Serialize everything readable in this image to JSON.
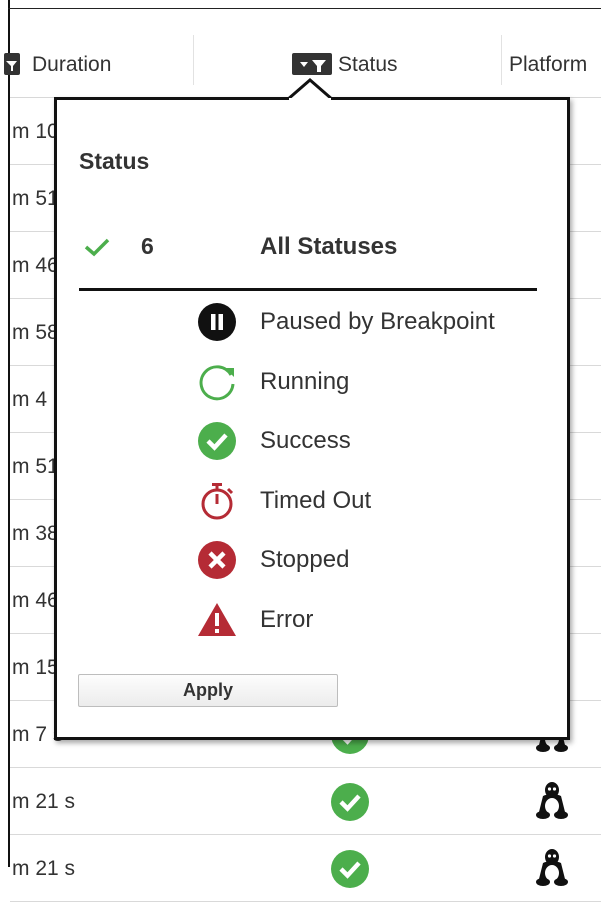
{
  "header": {
    "duration_label": "Duration",
    "status_label": "Status",
    "platform_label": "Platform"
  },
  "rows": [
    {
      "duration": "m 10"
    },
    {
      "duration": "m 51"
    },
    {
      "duration": "m 46"
    },
    {
      "duration": "m 58"
    },
    {
      "duration": " m 4"
    },
    {
      "duration": "m 51"
    },
    {
      "duration": "m 38"
    },
    {
      "duration": "m 46"
    },
    {
      "duration": "m 15"
    },
    {
      "duration": "m 7 s",
      "status_icon": "success-icon",
      "platform_icon": "linux-icon"
    },
    {
      "duration": "m 21 s",
      "status_icon": "success-icon",
      "platform_icon": "linux-icon"
    },
    {
      "duration": "m 21 s",
      "status_icon": "success-icon",
      "platform_icon": "linux-icon"
    }
  ],
  "popover": {
    "title": "Status",
    "all": {
      "count": "6",
      "label": "All Statuses",
      "checked": true
    },
    "options": [
      {
        "label": "Paused by Breakpoint",
        "icon": "pause-icon"
      },
      {
        "label": "Running",
        "icon": "running-icon"
      },
      {
        "label": "Success",
        "icon": "success-icon"
      },
      {
        "label": "Timed Out",
        "icon": "timer-icon"
      },
      {
        "label": "Stopped",
        "icon": "stopped-icon"
      },
      {
        "label": "Error",
        "icon": "error-icon"
      }
    ],
    "apply_label": "Apply"
  },
  "colors": {
    "success": "#4cae4c",
    "danger": "#b52b35",
    "check": "#4cae4c",
    "border": "#111111"
  }
}
